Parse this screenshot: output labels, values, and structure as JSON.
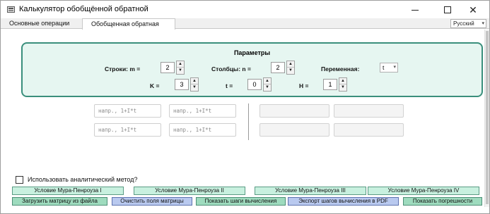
{
  "window": {
    "title": "Калькулятор обобщённой обратной"
  },
  "tabs": [
    {
      "label": "Основные операции"
    },
    {
      "label": "Обобщенная обратная"
    }
  ],
  "language": {
    "selected": "Русский"
  },
  "params": {
    "title": "Параметры",
    "rows_label": "Строки: m =",
    "rows_value": "2",
    "cols_label": "Столбцы: n =",
    "cols_value": "2",
    "var_label": "Переменная:",
    "var_value": "t",
    "k_label": "K =",
    "k_value": "3",
    "t_label": "t =",
    "t_value": "0",
    "h_label": "H =",
    "h_value": "1"
  },
  "matrix": {
    "placeholder": "напр., 1+I*t"
  },
  "analytic": {
    "label": "Использовать аналитический метод?"
  },
  "conditions": [
    {
      "label": "Условие Мура-Пенроуза I"
    },
    {
      "label": "Условие Мура-Пенроуза II"
    },
    {
      "label": "Условие Мура-Пенроуза III"
    },
    {
      "label": "Условие Мура-Пенроуза IV"
    }
  ],
  "actions": [
    {
      "label": "Загрузить матрицу из файла"
    },
    {
      "label": "Очистить поля матрицы"
    },
    {
      "label": "Показать шаги вычисления"
    },
    {
      "label": "Экспорт шагов вычисления в PDF"
    },
    {
      "label": "Показать погрешности"
    }
  ],
  "colors": {
    "panel_bg": "#e6f6f1",
    "panel_border": "#3a8f7c",
    "condition_button": "#c8f0df",
    "action_green": "#9edbbe",
    "action_blue": "#b9c9ef"
  }
}
